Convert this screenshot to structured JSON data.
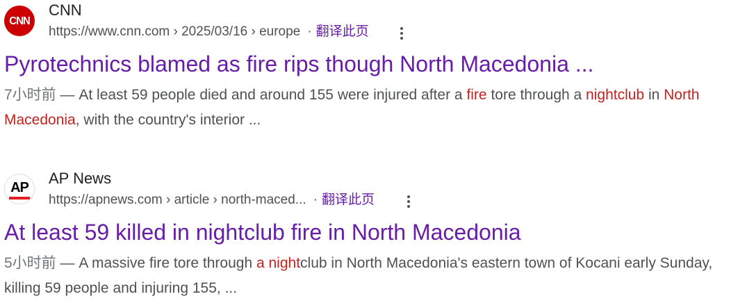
{
  "results": [
    {
      "site_name": "CNN",
      "favicon_text": "CNN",
      "favicon_color": "#cc0000",
      "url_path": "https://www.cnn.com › 2025/03/16 › europe",
      "translate_dot": "·",
      "translate_label": "翻译此页",
      "more_icon": "three-dots-vertical-icon",
      "title": "Pyrotechnics blamed as fire rips though North Macedonia ...",
      "date": "7小时前",
      "snippet_parts": [
        " — At least 59 people died and around 155 were injured after a ",
        "fire",
        " tore through a ",
        "nightclub",
        " in ",
        "North Macedonia",
        ", with the country's interior ..."
      ]
    },
    {
      "site_name": "AP News",
      "favicon_text": "AP",
      "favicon_color": "#e41e26",
      "url_path": "https://apnews.com › article › north-maced...",
      "translate_dot": "·",
      "translate_label": "翻译此页",
      "more_icon": "three-dots-vertical-icon",
      "title": "At least 59 killed in nightclub fire in North Macedonia",
      "date": "5小时前",
      "snippet_parts": [
        " — A massive fire tore through ",
        "a night",
        "club in North Macedonia's eastern town of Kocani early Sunday, killing 59 people and injuring 155, ..."
      ]
    }
  ],
  "colors": {
    "title_visited": "#681da8",
    "highlight": "#c5221f",
    "cite_text": "#4d5156"
  }
}
